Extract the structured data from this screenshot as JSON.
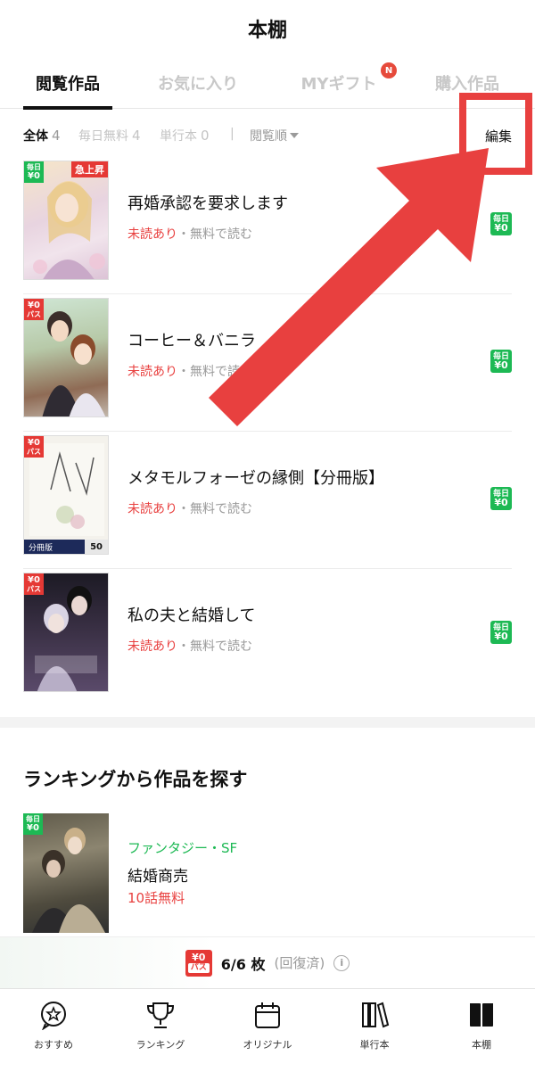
{
  "header": {
    "title": "本棚"
  },
  "tabs": [
    {
      "label": "閲覧作品",
      "active": true
    },
    {
      "label": "お気に入り",
      "active": false
    },
    {
      "label": "MYギフト",
      "active": false,
      "badge": "N"
    },
    {
      "label": "購入作品",
      "active": false
    }
  ],
  "filters": {
    "all": {
      "label": "全体",
      "count": "4"
    },
    "daily_free": {
      "label": "毎日無料",
      "count": "4"
    },
    "volume": {
      "label": "単行本",
      "count": "0"
    },
    "separator": "|",
    "sort_label": "閲覧順",
    "edit_label": "編集"
  },
  "books": [
    {
      "title": "再婚承認を要求します",
      "unread": "未読あり",
      "free": "・無料で読む",
      "cover_badge": {
        "top": "毎日",
        "bottom": "¥0"
      },
      "cover_tag": "急上昇",
      "side_badge": {
        "top": "毎日",
        "bottom": "¥0"
      }
    },
    {
      "title": "コーヒー＆バニラ",
      "unread": "未読あり",
      "free": "・無料で読む",
      "cover_badge": {
        "top": "¥0",
        "bottom": "パス"
      },
      "side_badge": {
        "top": "毎日",
        "bottom": "¥0"
      }
    },
    {
      "title": "メタモルフォーゼの縁側【分冊版】",
      "unread": "未読あり",
      "free": "・無料で読む",
      "cover_badge": {
        "top": "¥0",
        "bottom": "パス"
      },
      "cover_band": "分冊版",
      "cover_volume": "50",
      "side_badge": {
        "top": "毎日",
        "bottom": "¥0"
      }
    },
    {
      "title": "私の夫と結婚して",
      "unread": "未読あり",
      "free": "・無料で読む",
      "cover_badge": {
        "top": "¥0",
        "bottom": "パス"
      },
      "side_badge": {
        "top": "毎日",
        "bottom": "¥0"
      }
    }
  ],
  "ranking": {
    "title": "ランキングから作品を探す",
    "item": {
      "genre": "ファンタジー・SF",
      "title": "結婚商売",
      "free": "10話無料",
      "cover_badge": {
        "top": "毎日",
        "bottom": "¥0"
      }
    }
  },
  "pass_bar": {
    "logo_top": "¥0",
    "logo_bottom": "パス",
    "count": "6/6 枚",
    "note": "(回復済)",
    "info": "i"
  },
  "nav": [
    {
      "label": "おすすめ",
      "icon": "star-bubble-icon"
    },
    {
      "label": "ランキング",
      "icon": "trophy-icon"
    },
    {
      "label": "オリジナル",
      "icon": "calendar-icon"
    },
    {
      "label": "単行本",
      "icon": "books-icon"
    },
    {
      "label": "本棚",
      "icon": "bookshelf-icon"
    }
  ],
  "colors": {
    "accent_red": "#e8403f",
    "daily_green": "#1db954",
    "text": "#111111",
    "muted": "#9a9a9a"
  }
}
